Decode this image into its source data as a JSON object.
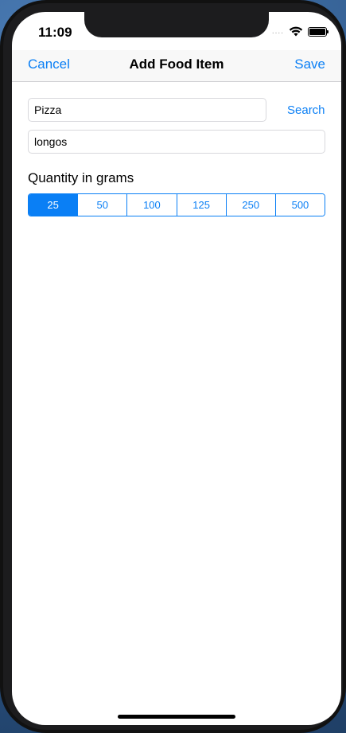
{
  "status_bar": {
    "time": "11:09",
    "signal": "....",
    "icons": [
      "signal-dots-icon",
      "wifi-icon",
      "battery-icon"
    ]
  },
  "nav": {
    "cancel_label": "Cancel",
    "title": "Add Food Item",
    "save_label": "Save"
  },
  "form": {
    "food_name_value": "Pizza",
    "brand_value": "longos",
    "search_label": "Search",
    "quantity_label": "Quantity in grams",
    "quantity_options": [
      "25",
      "50",
      "100",
      "125",
      "250",
      "500"
    ],
    "selected_quantity": "25"
  },
  "colors": {
    "accent": "#0a7ff5",
    "background": "#ffffff",
    "bezel": "#1c1c1e"
  }
}
